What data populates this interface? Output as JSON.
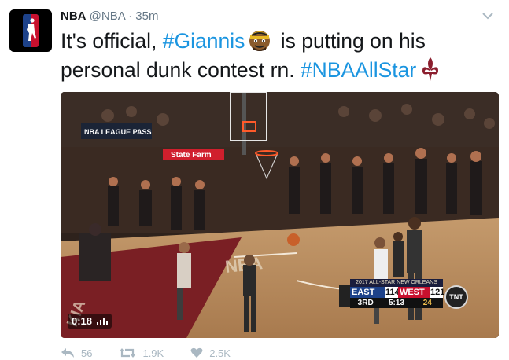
{
  "tweet": {
    "name": "NBA",
    "handle": "@NBA",
    "separator": "·",
    "time": "35m",
    "text_pre": "It's official, ",
    "hashtag1": "#Giannis",
    "text_mid": " is putting on his personal dunk contest rn. ",
    "hashtag2": "#NBAAllStar",
    "emoji1": "basketball-player-emoji",
    "emoji2": "fleur-de-lis-emoji"
  },
  "video": {
    "duration": "0:18",
    "court_signs": {
      "league_pass": "NBA LEAGUE PASS",
      "sponsor": "State Farm"
    },
    "scorebug": {
      "header": "2017 ALL-STAR NEW ORLEANS",
      "team1": "EAST",
      "score1": "114",
      "team2": "WEST",
      "score2": "121",
      "quarter": "3RD",
      "clock": "5:13",
      "shot_clock": "24",
      "network": "TNT"
    }
  },
  "actions": {
    "replies": "56",
    "retweets": "1.9K",
    "likes": "2.5K"
  },
  "colors": {
    "link": "#1b95e0",
    "muted": "#657786",
    "action": "#aab8c2",
    "east": "#1d428a",
    "west": "#c8102e"
  }
}
